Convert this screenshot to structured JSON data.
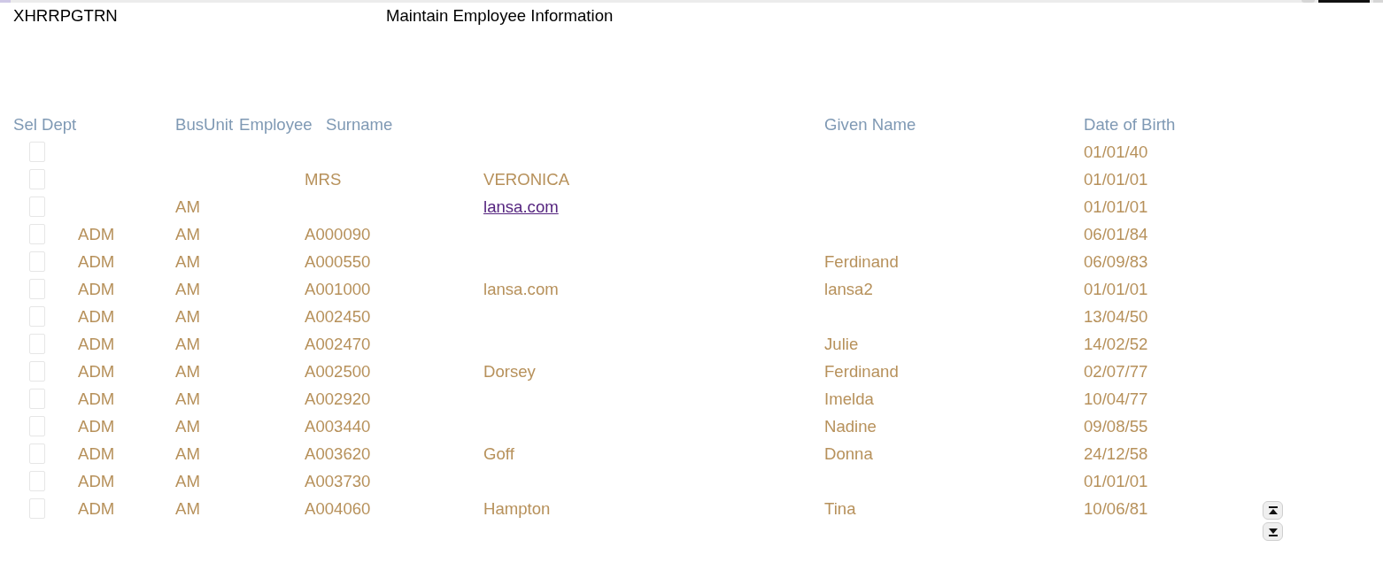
{
  "header": {
    "program": "XHRRPGTRN",
    "title": "Maintain Employee Information"
  },
  "table": {
    "columns": [
      "Sel",
      "Dept",
      "BusUnit",
      "Employee",
      "Surname",
      "Given Name",
      "Date of Birth"
    ],
    "rows": [
      {
        "checked": false,
        "date_of_birth": "01/01/40"
      },
      {
        "checked": false,
        "employee": "MRS",
        "surname": "VERONICA",
        "surname_link": false,
        "date_of_birth": "01/01/01"
      },
      {
        "checked": false,
        "bus_unit": "AM",
        "surname": "lansa.com",
        "surname_link": true,
        "date_of_birth": "01/01/01"
      },
      {
        "checked": false,
        "dept": "ADM",
        "bus_unit": "AM",
        "employee": "A000090",
        "date_of_birth": "06/01/84"
      },
      {
        "checked": false,
        "dept": "ADM",
        "bus_unit": "AM",
        "employee": "A000550",
        "given_name": "Ferdinand",
        "date_of_birth": "06/09/83"
      },
      {
        "checked": false,
        "dept": "ADM",
        "bus_unit": "AM",
        "employee": "A001000",
        "surname": "lansa.com",
        "surname_link": false,
        "given_name": "lansa2",
        "date_of_birth": "01/01/01"
      },
      {
        "checked": false,
        "dept": "ADM",
        "bus_unit": "AM",
        "employee": "A002450",
        "date_of_birth": "13/04/50"
      },
      {
        "checked": false,
        "dept": "ADM",
        "bus_unit": "AM",
        "employee": "A002470",
        "given_name": "Julie",
        "date_of_birth": "14/02/52"
      },
      {
        "checked": false,
        "dept": "ADM",
        "bus_unit": "AM",
        "employee": "A002500",
        "surname": "Dorsey",
        "surname_link": false,
        "given_name": "Ferdinand",
        "date_of_birth": "02/07/77"
      },
      {
        "checked": false,
        "dept": "ADM",
        "bus_unit": "AM",
        "employee": "A002920",
        "given_name": "Imelda",
        "date_of_birth": "10/04/77"
      },
      {
        "checked": false,
        "dept": "ADM",
        "bus_unit": "AM",
        "employee": "A003440",
        "given_name": "Nadine",
        "date_of_birth": "09/08/55"
      },
      {
        "checked": false,
        "dept": "ADM",
        "bus_unit": "AM",
        "employee": "A003620",
        "surname": "Goff",
        "surname_link": false,
        "given_name": "Donna",
        "date_of_birth": "24/12/58"
      },
      {
        "checked": false,
        "dept": "ADM",
        "bus_unit": "AM",
        "employee": "A003730",
        "date_of_birth": "01/01/01"
      },
      {
        "checked": false,
        "dept": "ADM",
        "bus_unit": "AM",
        "employee": "A004060",
        "surname": "Hampton",
        "surname_link": false,
        "given_name": "Tina",
        "date_of_birth": "10/06/81"
      }
    ]
  }
}
